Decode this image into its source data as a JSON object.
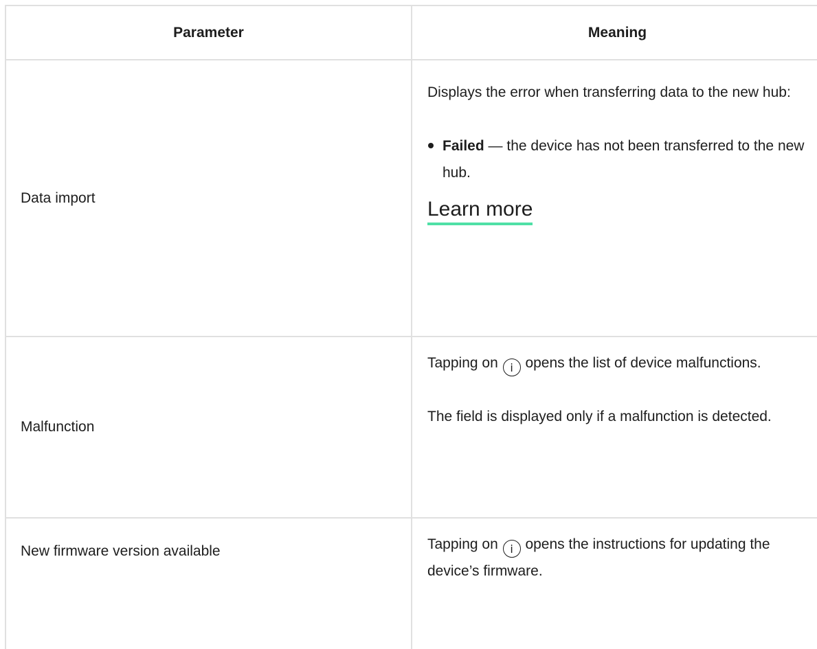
{
  "table": {
    "headers": {
      "parameter": "Parameter",
      "meaning": "Meaning"
    },
    "rows": [
      {
        "parameter": "Data import",
        "meaning_intro": "Displays the error when transferring data to the new hub:",
        "bullet_bold": "Failed",
        "bullet_text": " — the device has not been transferred to the new hub.",
        "link": "Learn more"
      },
      {
        "parameter": "Malfunction",
        "meaning_a": "Tapping on",
        "info_glyph": "i",
        "meaning_b": "opens the list of device malfunctions.",
        "meaning_note": "The field is displayed only if a malfunction is detected."
      },
      {
        "parameter": "New firmware version available",
        "meaning_a": "Tapping on",
        "info_glyph": "i",
        "meaning_b": "opens the instructions for updating the device’s firmware."
      }
    ]
  },
  "colors": {
    "border": "#e0e0e0",
    "text": "#1d1d1d",
    "link_underline": "#4fe0a6"
  }
}
